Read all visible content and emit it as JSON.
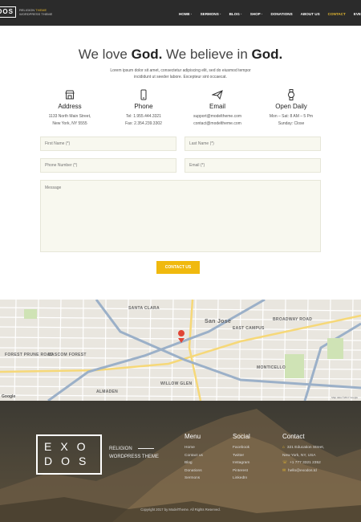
{
  "header": {
    "logo_text": "DOS",
    "logo_tag_1": "RELIGION",
    "logo_tag_hl": "THEME",
    "logo_tag_2": "WORDPRESS THEME",
    "nav": [
      {
        "label": "HOME ·"
      },
      {
        "label": "SERMONS ·"
      },
      {
        "label": "BLOG ·"
      },
      {
        "label": "SHOP ·"
      },
      {
        "label": "DONATIONS"
      },
      {
        "label": "ABOUT US"
      },
      {
        "label": "CONTACT"
      },
      {
        "label": "EVE"
      }
    ]
  },
  "intro": {
    "title_a": "We love ",
    "title_b": "God.",
    "title_c": " We believe in ",
    "title_d": "God.",
    "subtitle": "Lorem ipsum dolor sit amet, consectetur adipiscing elit, sed do eiusmod tempor incididunt ut seeder labore. Excepteur sint occaecat."
  },
  "info": [
    {
      "icon": "store-icon",
      "heading": "Address",
      "line1": "1133 North Main Street,",
      "line2": "New York, NY 5555"
    },
    {
      "icon": "phone-icon",
      "heading": "Phone",
      "line1": "Tel: 1.955.444.3321",
      "line2": "Fax: 2.354.239.3302"
    },
    {
      "icon": "paper-plane-icon",
      "heading": "Email",
      "line1": "support@modeltheme.com",
      "line2": "contact@modeltheme.com"
    },
    {
      "icon": "watch-icon",
      "heading": "Open Daily",
      "line1": "Mon – Sat: 8 AM – 5 Pm",
      "line2": "Sunday: Close"
    }
  ],
  "form": {
    "first_name": "First Name (*)",
    "last_name": "Last Name (*)",
    "phone": "Phone Number (*)",
    "email": "Email (*)",
    "message": "Message",
    "submit": "CONTACT US"
  },
  "map": {
    "city": "San Jose",
    "labels": [
      "EAST CAMPUS",
      "BROADWAY ROAD",
      "FOREST PRUNE ROAD",
      "BASCOM FOREST",
      "SANTA CLARA",
      "WILLOW GLEN",
      "ALMADEN",
      "MONTICELLO"
    ],
    "google": "Google",
    "copyright": "Map data ©2017 Google"
  },
  "footer": {
    "logo_line1": "EXO",
    "logo_line2": "DOS",
    "tag1": "RELIGION",
    "tag2": "WORDPRESS THEME",
    "menu_heading": "Menu",
    "menu": [
      "Home",
      "Contact us",
      "Blog",
      "Donations",
      "Sermons"
    ],
    "social_heading": "Social",
    "social": [
      "Facebook",
      "Twitter",
      "Instagram",
      "Pinterest",
      "LinkedIn"
    ],
    "contact_heading": "Contact",
    "contact": [
      {
        "icon": "home-icon",
        "text": "321 Education Street,"
      },
      {
        "icon": "",
        "text": "New York, NY, USA"
      },
      {
        "icon": "phone-icon",
        "text": "+1 777 3321 2352"
      },
      {
        "icon": "mail-icon",
        "text": "hello@exodos.td"
      }
    ],
    "copyright": "Copyright 2017 by ModelTheme. All Rights Reserved."
  },
  "colors": {
    "accent": "#f0b90e",
    "header_bg": "#2b2b2b",
    "field_bg": "#f8f8ef"
  }
}
